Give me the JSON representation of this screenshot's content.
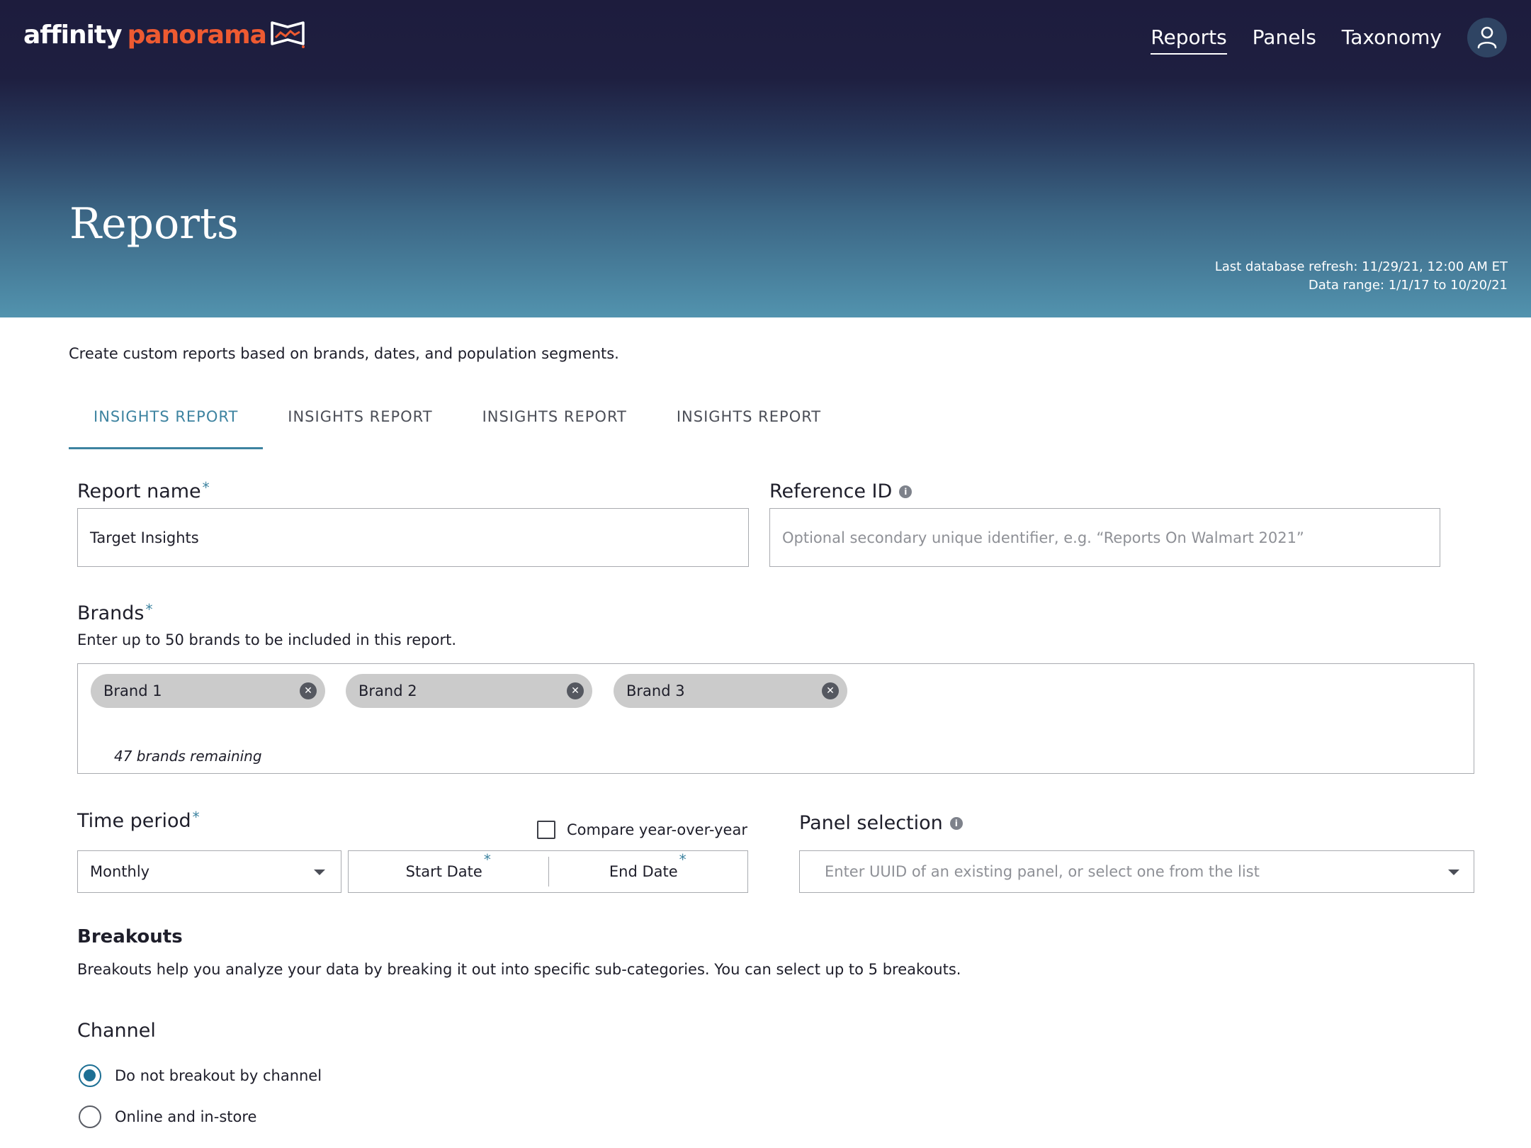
{
  "brand": {
    "name_part1": "affinity",
    "name_part2": "panorama",
    "logo_icon": "panorama-flag-icon"
  },
  "nav": {
    "items": [
      {
        "label": "Reports",
        "active": true
      },
      {
        "label": "Panels",
        "active": false
      },
      {
        "label": "Taxonomy",
        "active": false
      }
    ],
    "profile_icon": "user-icon"
  },
  "header": {
    "title": "Reports",
    "last_refresh": "Last database refresh: 11/29/21, 12:00 AM ET",
    "data_range": "Data range: 1/1/17 to 10/20/21"
  },
  "intro": "Create custom reports based on brands, dates, and population segments.",
  "tabs": [
    {
      "label": "INSIGHTS REPORT",
      "active": true
    },
    {
      "label": "INSIGHTS REPORT",
      "active": false
    },
    {
      "label": "INSIGHTS REPORT",
      "active": false
    },
    {
      "label": "INSIGHTS REPORT",
      "active": false
    }
  ],
  "form": {
    "report_name": {
      "label": "Report name",
      "required_mark": "*",
      "value": "Target Insights"
    },
    "reference_id": {
      "label": "Reference ID",
      "info_icon": "info-icon",
      "placeholder": "Optional secondary unique identifier, e.g. “Reports On Walmart 2021”"
    },
    "brands": {
      "label": "Brands",
      "required_mark": "*",
      "helper": "Enter up to 50 brands to be included in this report.",
      "chips": [
        "Brand 1",
        "Brand 2",
        "Brand 3"
      ],
      "remaining": "47 brands remaining"
    },
    "time_period": {
      "label": "Time period",
      "required_mark": "*",
      "compare_label": "Compare year-over-year",
      "compare_checked": false,
      "frequency": "Monthly",
      "start_date": "Start Date",
      "end_date": "End Date",
      "date_required_mark": "*"
    },
    "panel_selection": {
      "label": "Panel selection",
      "info_icon": "info-icon",
      "placeholder": "Enter UUID of an existing panel, or select one from the list"
    },
    "breakouts": {
      "title": "Breakouts",
      "description": "Breakouts help you analyze your data by breaking it out into specific sub-categories. You can select up to 5 breakouts."
    },
    "channel": {
      "title": "Channel",
      "options": [
        {
          "label": "Do not breakout by channel",
          "checked": true
        },
        {
          "label": "Online and in-store",
          "checked": false
        }
      ]
    }
  },
  "colors": {
    "accent": "#3d83a0",
    "logo_orange": "#ee5a31",
    "radio_selected": "#1d6f94",
    "header_top": "#1d1c3d",
    "header_bottom": "#5293ae"
  }
}
